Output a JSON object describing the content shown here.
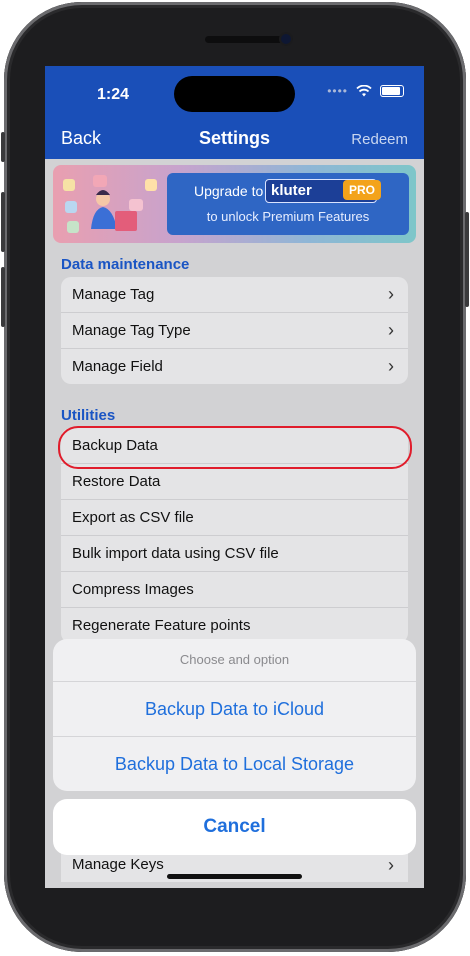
{
  "status_bar": {
    "time": "1:24"
  },
  "nav": {
    "back_label": "Back",
    "title": "Settings",
    "redeem_label": "Redeem"
  },
  "banner": {
    "upgrade_text": "Upgrade to",
    "brand": "kluter",
    "pro_badge": "PRO",
    "subtitle": "to unlock Premium Features"
  },
  "data_maintenance": {
    "header": "Data maintenance",
    "items": [
      {
        "label": "Manage Tag"
      },
      {
        "label": "Manage Tag Type"
      },
      {
        "label": "Manage Field"
      }
    ]
  },
  "utilities": {
    "header": "Utilities",
    "items": [
      {
        "label": "Backup Data"
      },
      {
        "label": "Restore Data"
      },
      {
        "label": "Export as CSV file"
      },
      {
        "label": "Bulk import data using CSV file"
      },
      {
        "label": "Compress Images"
      },
      {
        "label": "Regenerate Feature points"
      }
    ],
    "bottom_item": "Manage Keys"
  },
  "action_sheet": {
    "title": "Choose and option",
    "options": [
      {
        "label": "Backup Data to iCloud"
      },
      {
        "label": "Backup Data to Local Storage"
      }
    ],
    "cancel_label": "Cancel"
  },
  "colors": {
    "nav_blue": "#1a4fb8",
    "accent_blue": "#1f6fdc",
    "highlight_red": "#e01c2b",
    "pro_orange": "#f3a31b"
  }
}
